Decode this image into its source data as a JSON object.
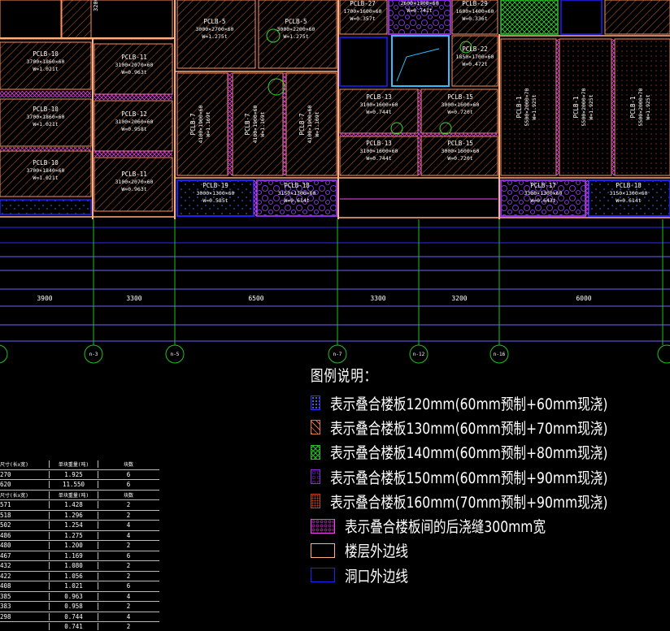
{
  "drawing": {
    "slabs": [
      {
        "id": "s1",
        "label": "PCLB-10",
        "dims": "3700×1860×60",
        "weight": "W=1.021t",
        "pattern": "hatch"
      },
      {
        "id": "s2",
        "label": "PCLB-10",
        "dims": "3700×1860×60",
        "weight": "W=1.021t",
        "pattern": "hatch"
      },
      {
        "id": "s3",
        "label": "PCLB-10",
        "dims": "3700×1840×60",
        "weight": "W=1.021t",
        "pattern": "hatch"
      },
      {
        "id": "s4",
        "label": "PCLB-11",
        "dims": "3100×2070×60",
        "weight": "W=0.963t",
        "pattern": "hatch"
      },
      {
        "id": "s5",
        "label": "PCLB-12",
        "dims": "3100×2060×60",
        "weight": "W=0.958t",
        "pattern": "hatch"
      },
      {
        "id": "s6",
        "label": "PCLB-11",
        "dims": "3100×2070×60",
        "weight": "W=0.963t",
        "pattern": "hatch"
      },
      {
        "id": "s7",
        "label": "PCLB-5",
        "dims": "3000×2700×60",
        "weight": "W=1.275t",
        "pattern": "hatch"
      },
      {
        "id": "s8",
        "label": "PCLB-5",
        "dims": "3000×2200×60",
        "weight": "W=1.275t",
        "pattern": "hatch"
      },
      {
        "id": "s9",
        "label": "PCLB-7",
        "dims": "4100×1900×60",
        "weight": "W=1.169t",
        "pattern": "hatch",
        "vertical": true
      },
      {
        "id": "s10",
        "label": "PCLB-7",
        "dims": "4100×1900×60",
        "weight": "W=1.169t",
        "pattern": "hatch",
        "vertical": true
      },
      {
        "id": "s11",
        "label": "PCLB-7",
        "dims": "4100×1900×60",
        "weight": "W=1.169t",
        "pattern": "hatch",
        "vertical": true
      },
      {
        "id": "s12",
        "label": "PCLB-27",
        "dims": "1700×1600×60",
        "weight": "W=0.357t",
        "pattern": "hatch"
      },
      {
        "id": "s13",
        "label": "PCLB-16",
        "dims": "2600×1900×60",
        "weight": "W=0.741t",
        "pattern": "purple"
      },
      {
        "id": "s14",
        "label": "PCLB-29",
        "dims": "1600×1400×60",
        "weight": "W=0.336t",
        "pattern": "hatch"
      },
      {
        "id": "s15",
        "label": "PCLB-22",
        "dims": "1850×1700×60",
        "weight": "W=0.472t",
        "pattern": "hatch"
      },
      {
        "id": "s16",
        "label": "PCLB-13",
        "dims": "3100×1600×60",
        "weight": "W=0.744t",
        "pattern": "hatch"
      },
      {
        "id": "s17",
        "label": "PCLB-15",
        "dims": "3000×1600×60",
        "weight": "W=0.720t",
        "pattern": "hatch"
      },
      {
        "id": "s18",
        "label": "PCLB-13",
        "dims": "3100×1600×60",
        "weight": "W=0.744t",
        "pattern": "hatch"
      },
      {
        "id": "s19",
        "label": "PCLB-15",
        "dims": "3000×1600×60",
        "weight": "W=0.720t",
        "pattern": "hatch"
      },
      {
        "id": "s20",
        "label": "PCLB-1",
        "dims": "5500×2000×70",
        "weight": "W=1.925t",
        "pattern": "dots",
        "vertical": true
      },
      {
        "id": "s21",
        "label": "PCLB-1",
        "dims": "5500×2000×70",
        "weight": "W=1.925t",
        "pattern": "dots",
        "vertical": true
      },
      {
        "id": "s22",
        "label": "PCLB-1",
        "dims": "5500×2000×70",
        "weight": "W=1.925t",
        "pattern": "dots",
        "vertical": true
      },
      {
        "id": "s23",
        "label": "PCLB-19",
        "dims": "3000×1300×60",
        "weight": "W=0.585t",
        "pattern": "blue"
      },
      {
        "id": "s24",
        "label": "PCLB-18",
        "dims": "3150×1300×60",
        "weight": "W=0.614t",
        "pattern": "purple"
      },
      {
        "id": "s25",
        "label": "PCLB-17",
        "dims": "3300×1300×60",
        "weight": "W=0.643t",
        "pattern": "purple"
      },
      {
        "id": "s26",
        "label": "PCLB-18",
        "dims": "3150×1300×60",
        "weight": "W=0.614t",
        "pattern": "blue"
      }
    ],
    "top_partial_label": "3200×",
    "spans": [
      "3900",
      "3300",
      "6500",
      "3300",
      "3200",
      "6000"
    ],
    "axis_bubbles": [
      "n-3",
      "n-5",
      "n-7",
      "n-12",
      "n-16"
    ]
  },
  "legend": {
    "title": "图例说明：",
    "items": [
      {
        "text": "表示叠合楼板120mm(60mm预制+60mm现浇)",
        "swatch": "blue-dots",
        "color": "#3030ff"
      },
      {
        "text": "表示叠合楼板130mm(60mm预制+70mm现浇)",
        "swatch": "orange-hatch",
        "color": "#e07840"
      },
      {
        "text": "表示叠合楼板140mm(60mm预制+80mm现浇)",
        "swatch": "green-cross",
        "color": "#20c020"
      },
      {
        "text": "表示叠合楼板150mm(60mm预制+90mm现浇)",
        "swatch": "purple-dots",
        "color": "#8a2be2"
      },
      {
        "text": "表示叠合楼板160mm(70mm预制+90mm现浇)",
        "swatch": "brown-dots",
        "color": "#c04020"
      },
      {
        "text": "表示叠合楼板间的后浇缝300mm宽",
        "swatch": "magenta-cross",
        "color": "#ff40ff"
      },
      {
        "text": "楼层外边线",
        "swatch": "outline-orange",
        "color": "#ffb080"
      },
      {
        "text": "洞口外边线",
        "swatch": "outline-blue",
        "color": "#2020ff"
      }
    ]
  },
  "table": {
    "headers_a": [
      "尺寸(长x宽)",
      "单块重量(吨)",
      "块数"
    ],
    "rows_a": [
      [
        "270",
        "1.925",
        "6"
      ],
      [
        "620",
        "11.550",
        "6"
      ]
    ],
    "headers_b": [
      "尺寸(长x宽)",
      "单块重量(吨)",
      "块数"
    ],
    "rows_b": [
      [
        "571",
        "1.428",
        "2"
      ],
      [
        "518",
        "1.296",
        "2"
      ],
      [
        "502",
        "1.254",
        "4"
      ],
      [
        "486",
        "1.275",
        "4"
      ],
      [
        "480",
        "1.200",
        "2"
      ],
      [
        "467",
        "1.169",
        "6"
      ],
      [
        "432",
        "1.080",
        "2"
      ],
      [
        "422",
        "1.056",
        "2"
      ],
      [
        "408",
        "1.021",
        "6"
      ],
      [
        "385",
        "0.963",
        "4"
      ],
      [
        "383",
        "0.958",
        "2"
      ],
      [
        "298",
        "0.744",
        "4"
      ],
      [
        "",
        "0.741",
        "2"
      ]
    ]
  }
}
